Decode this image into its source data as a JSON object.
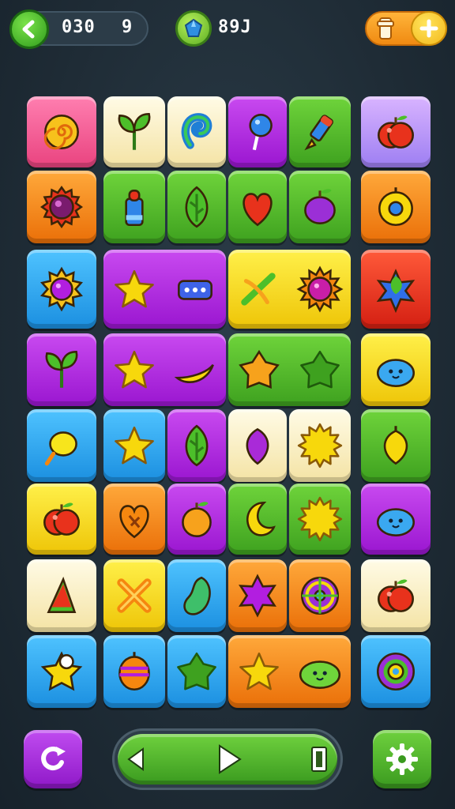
{
  "hud": {
    "score": "030",
    "level": "9",
    "gems": "89J"
  },
  "icons": {
    "back": "back-arrow-icon",
    "gem": "gem-icon",
    "shop": "shop-icon",
    "plus": "plus-icon",
    "shuffle": "shuffle-icon",
    "prev": "previous-icon",
    "play": "play-icon",
    "exit": "exit-door-icon",
    "settings": "gear-icon"
  },
  "colors": {
    "green": "#4cbf2a",
    "purple": "#b21ee0",
    "orange": "#f5870f",
    "yellow": "#f7d80c",
    "blue": "#27a6ea",
    "pink": "#f25e9a",
    "red": "#e8331f",
    "cream": "#fbf2cc"
  },
  "board": {
    "tiles": [
      {
        "r": 0,
        "c": 0,
        "w": 1,
        "fill": "pink",
        "items": [
          "swirl"
        ]
      },
      {
        "r": 0,
        "c": 1,
        "w": 1,
        "fill": "cream",
        "items": [
          "sprout"
        ]
      },
      {
        "r": 0,
        "c": 2,
        "w": 1,
        "fill": "cream",
        "items": [
          "swirl-blue"
        ]
      },
      {
        "r": 0,
        "c": 3,
        "w": 1,
        "fill": "purple",
        "items": [
          "lollipop"
        ]
      },
      {
        "r": 0,
        "c": 4,
        "w": 1,
        "fill": "green",
        "items": [
          "marker"
        ]
      },
      {
        "r": 0,
        "c": 5,
        "w": 1,
        "fill": "lilac",
        "items": [
          "apple"
        ]
      },
      {
        "r": 1,
        "c": 0,
        "w": 1,
        "fill": "orange",
        "items": [
          "gear-gem"
        ]
      },
      {
        "r": 1,
        "c": 1,
        "w": 1,
        "fill": "green",
        "items": [
          "bottle"
        ]
      },
      {
        "r": 1,
        "c": 2,
        "w": 1,
        "fill": "green",
        "items": [
          "leaf"
        ]
      },
      {
        "r": 1,
        "c": 3,
        "w": 1,
        "fill": "green",
        "items": [
          "heart-red"
        ]
      },
      {
        "r": 1,
        "c": 4,
        "w": 1,
        "fill": "green",
        "items": [
          "plum"
        ]
      },
      {
        "r": 1,
        "c": 5,
        "w": 1,
        "fill": "orange",
        "items": [
          "donut"
        ]
      },
      {
        "r": 2,
        "c": 0,
        "w": 1,
        "fill": "blue",
        "items": [
          "sun-gem"
        ]
      },
      {
        "r": 2,
        "c": 1,
        "w": 2,
        "fill": "purple",
        "items": [
          "star-yellow",
          "dots"
        ]
      },
      {
        "r": 2,
        "c": 3,
        "w": 2,
        "fill": "yellow",
        "items": [
          "cross-leaf",
          "burst-purple"
        ]
      },
      {
        "r": 2,
        "c": 5,
        "w": 1,
        "fill": "red",
        "items": [
          "star-blue"
        ]
      },
      {
        "r": 3,
        "c": 0,
        "w": 1,
        "fill": "purple",
        "items": [
          "sprout"
        ]
      },
      {
        "r": 3,
        "c": 1,
        "w": 2,
        "fill": "purple",
        "items": [
          "star-yellow",
          "banana"
        ]
      },
      {
        "r": 3,
        "c": 3,
        "w": 2,
        "fill": "green",
        "items": [
          "star-orange",
          "star-green"
        ]
      },
      {
        "r": 3,
        "c": 5,
        "w": 1,
        "fill": "yellow",
        "items": [
          "blob-blue"
        ]
      },
      {
        "r": 4,
        "c": 0,
        "w": 1,
        "fill": "blue",
        "items": [
          "lemon"
        ]
      },
      {
        "r": 4,
        "c": 1,
        "w": 1,
        "fill": "blue",
        "items": [
          "star-yellow"
        ]
      },
      {
        "r": 4,
        "c": 2,
        "w": 1,
        "fill": "purple",
        "items": [
          "leaf"
        ]
      },
      {
        "r": 4,
        "c": 3,
        "w": 1,
        "fill": "cream",
        "items": [
          "heart-purple"
        ]
      },
      {
        "r": 4,
        "c": 4,
        "w": 1,
        "fill": "cream",
        "items": [
          "burst-yellow"
        ]
      },
      {
        "r": 4,
        "c": 5,
        "w": 1,
        "fill": "green",
        "items": [
          "heart-yellow"
        ]
      },
      {
        "r": 5,
        "c": 0,
        "w": 1,
        "fill": "yellow",
        "items": [
          "apple"
        ]
      },
      {
        "r": 5,
        "c": 1,
        "w": 1,
        "fill": "orange",
        "items": [
          "heart-orange"
        ]
      },
      {
        "r": 5,
        "c": 2,
        "w": 1,
        "fill": "purple",
        "items": [
          "peach"
        ]
      },
      {
        "r": 5,
        "c": 3,
        "w": 1,
        "fill": "green",
        "items": [
          "moon"
        ]
      },
      {
        "r": 5,
        "c": 4,
        "w": 1,
        "fill": "green",
        "items": [
          "burst-yellow"
        ]
      },
      {
        "r": 5,
        "c": 5,
        "w": 1,
        "fill": "purple",
        "items": [
          "blob-blue"
        ]
      },
      {
        "r": 6,
        "c": 0,
        "w": 1,
        "fill": "cream",
        "items": [
          "watermelon"
        ]
      },
      {
        "r": 6,
        "c": 1,
        "w": 1,
        "fill": "yellow",
        "items": [
          "cross-orange"
        ]
      },
      {
        "r": 6,
        "c": 2,
        "w": 1,
        "fill": "blue",
        "items": [
          "bean-green"
        ]
      },
      {
        "r": 6,
        "c": 3,
        "w": 1,
        "fill": "orange",
        "items": [
          "star-purple"
        ]
      },
      {
        "r": 6,
        "c": 4,
        "w": 1,
        "fill": "orange",
        "items": [
          "wheel"
        ]
      },
      {
        "r": 6,
        "c": 5,
        "w": 1,
        "fill": "cream",
        "items": [
          "apple"
        ]
      },
      {
        "r": 7,
        "c": 0,
        "w": 1,
        "fill": "blue",
        "items": [
          "star-pearl"
        ]
      },
      {
        "r": 7,
        "c": 1,
        "w": 1,
        "fill": "blue",
        "items": [
          "striped-egg"
        ]
      },
      {
        "r": 7,
        "c": 2,
        "w": 1,
        "fill": "blue",
        "items": [
          "star-green"
        ]
      },
      {
        "r": 7,
        "c": 3,
        "w": 2,
        "fill": "orange",
        "items": [
          "star-yellow",
          "blob-green"
        ]
      },
      {
        "r": 7,
        "c": 5,
        "w": 1,
        "fill": "blue",
        "items": [
          "ring"
        ]
      }
    ]
  }
}
